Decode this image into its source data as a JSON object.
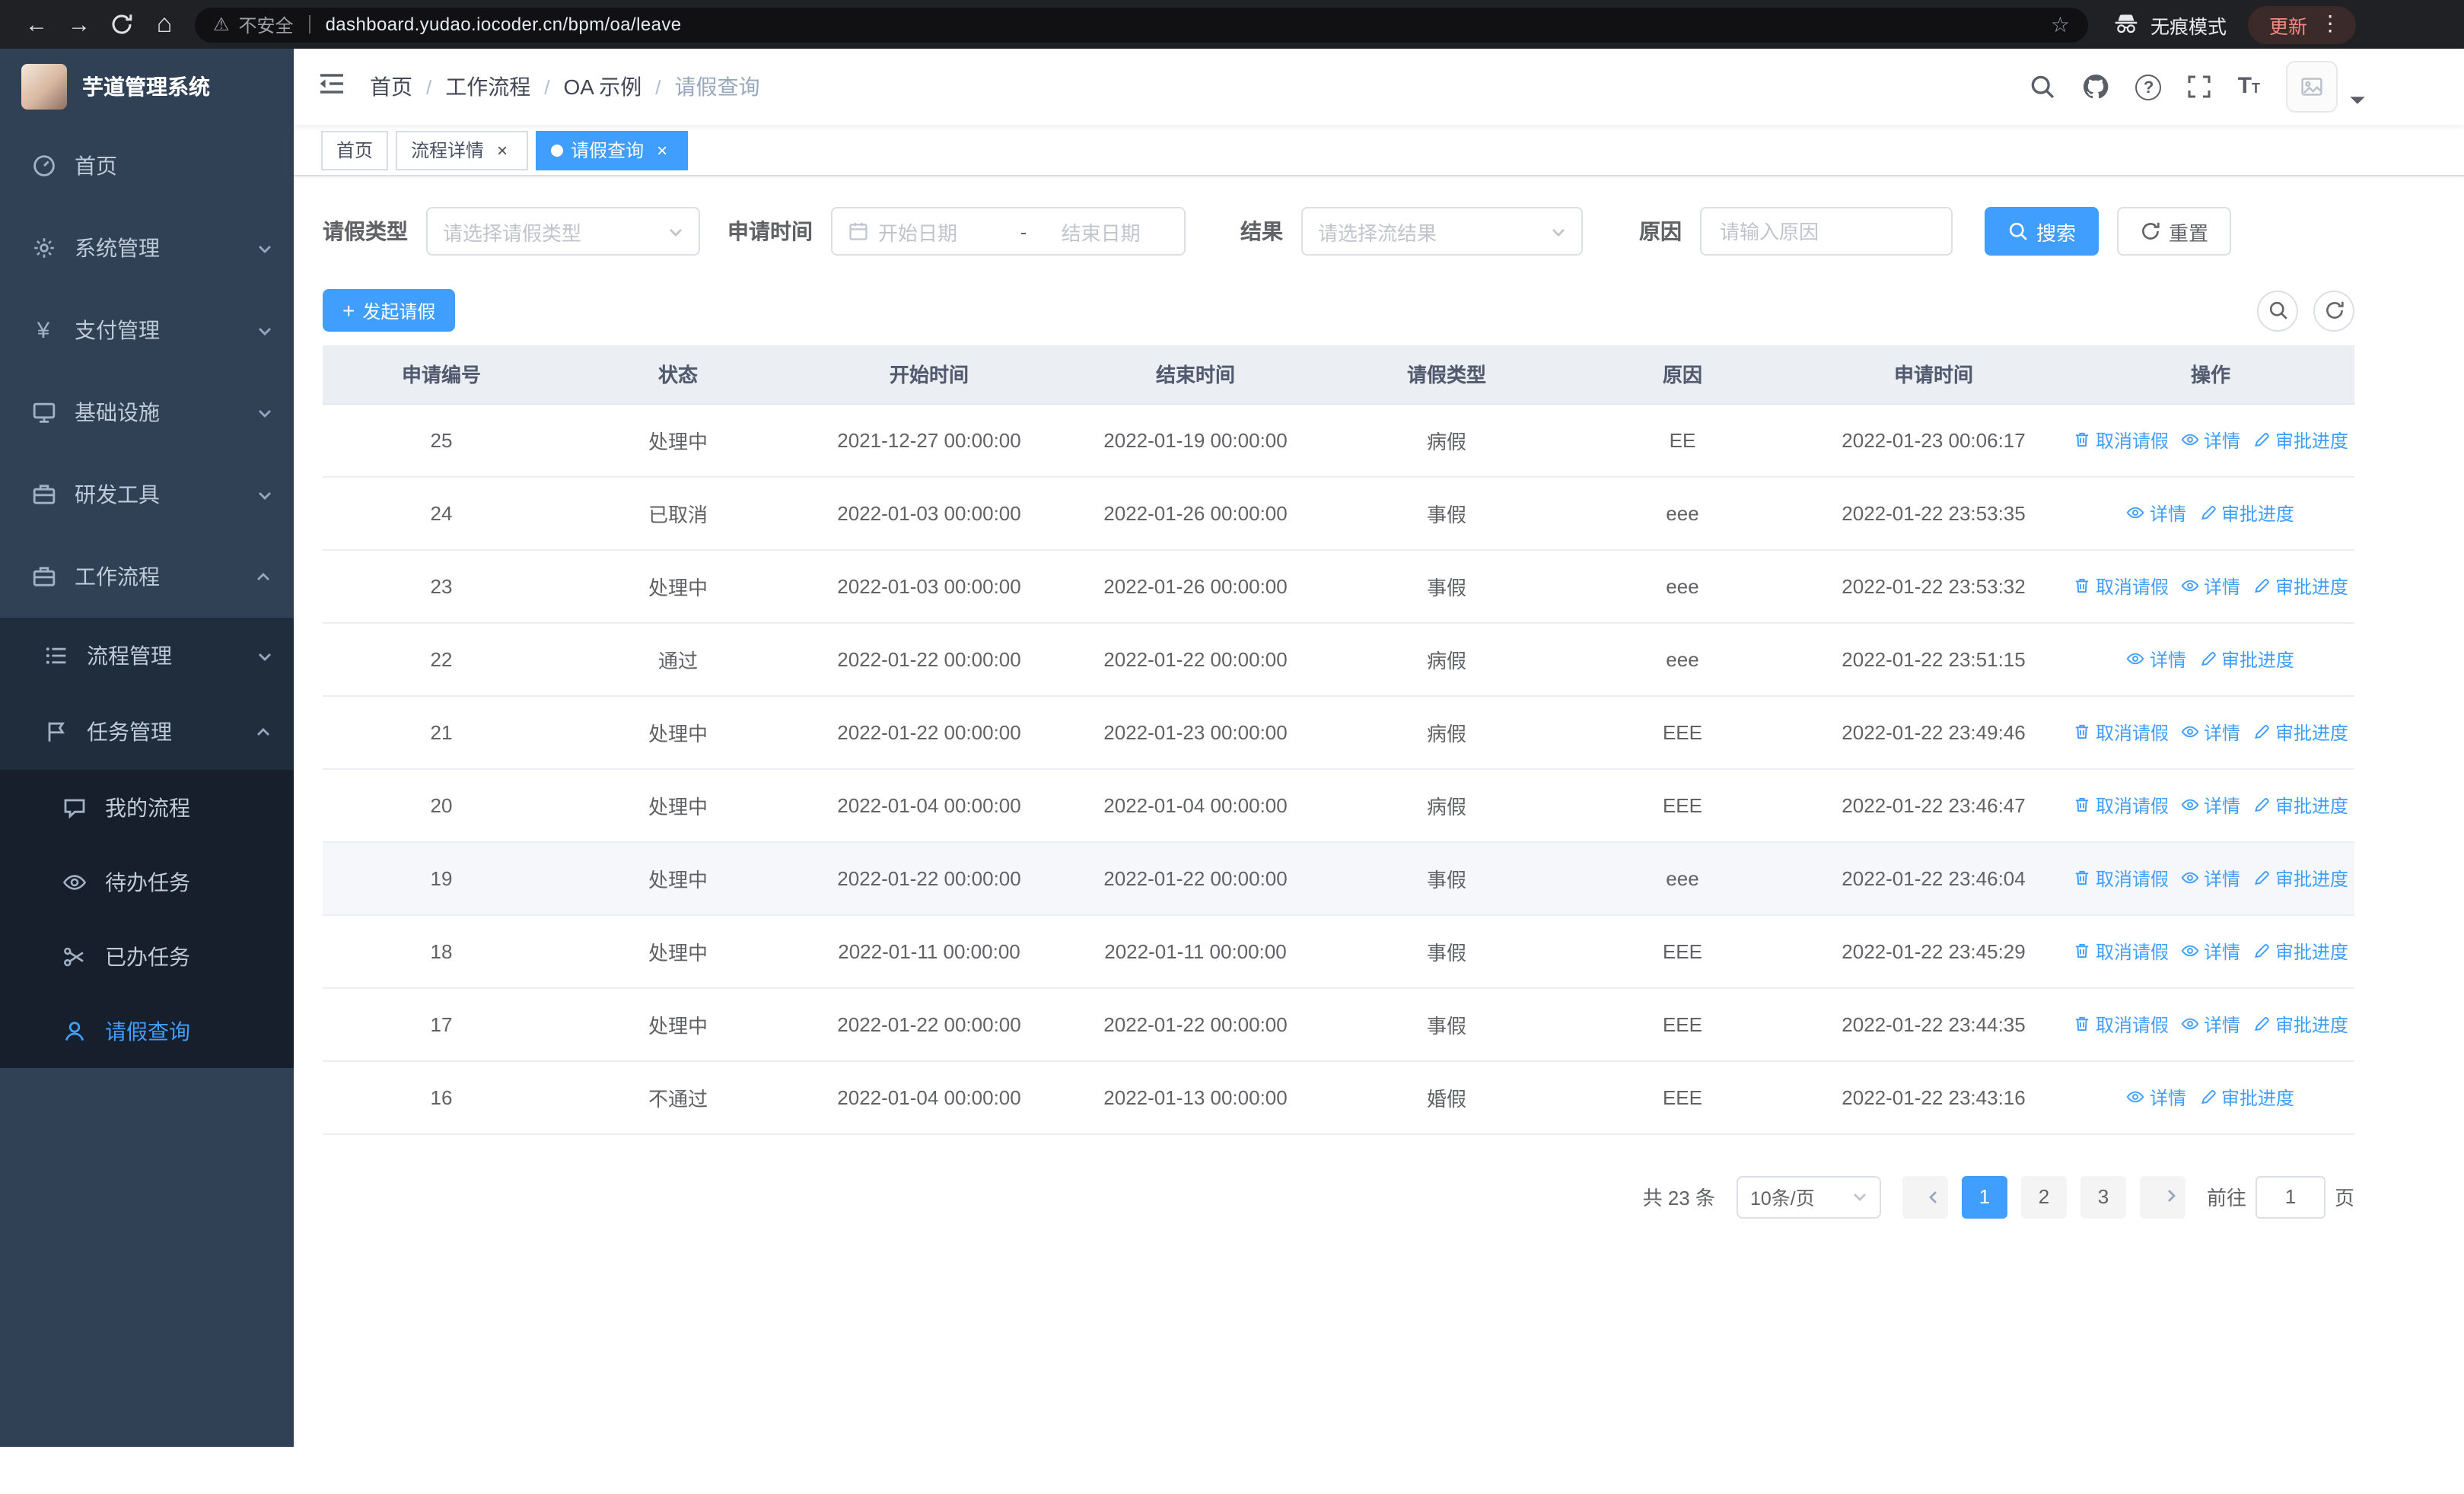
{
  "colors": {
    "accent": "#409eff",
    "sidebar_bg": "#304156",
    "sidebar_sub_bg": "#1f2d3d",
    "sidebar_subsub_bg": "#161f2b",
    "row_highlight": "#f5f7fa",
    "update_chip_text": "#f28b82"
  },
  "browser": {
    "security_label": "不安全",
    "url": "dashboard.yudao.iocoder.cn/bpm/oa/leave",
    "incognito_label": "无痕模式",
    "update_label": "更新"
  },
  "sidebar": {
    "title": "芋道管理系统",
    "logo_icon": "logo-image",
    "items": [
      {
        "label": "首页",
        "icon": "dashboard-icon",
        "has_children": false
      },
      {
        "label": "系统管理",
        "icon": "gear-icon",
        "has_children": true,
        "expanded": false
      },
      {
        "label": "支付管理",
        "icon": "yen-icon",
        "has_children": true,
        "expanded": false
      },
      {
        "label": "基础设施",
        "icon": "monitor-icon",
        "has_children": true,
        "expanded": false
      },
      {
        "label": "研发工具",
        "icon": "briefcase-icon",
        "has_children": true,
        "expanded": false
      },
      {
        "label": "工作流程",
        "icon": "suitcase-icon",
        "has_children": true,
        "expanded": true
      }
    ],
    "workflow_children": [
      {
        "label": "流程管理",
        "icon": "list-icon",
        "has_children": true,
        "expanded": false
      },
      {
        "label": "任务管理",
        "icon": "flag-icon",
        "has_children": true,
        "expanded": true
      }
    ],
    "task_children": [
      {
        "label": "我的流程",
        "icon": "chat-icon",
        "active": false
      },
      {
        "label": "待办任务",
        "icon": "eye-icon",
        "active": false
      },
      {
        "label": "已办任务",
        "icon": "scissors-icon",
        "active": false
      },
      {
        "label": "请假查询",
        "icon": "user-icon",
        "active": true
      }
    ]
  },
  "header": {
    "breadcrumb": [
      "首页",
      "工作流程",
      "OA 示例",
      "请假查询"
    ],
    "icons": [
      "search-icon",
      "github-icon",
      "help-icon",
      "fullscreen-icon",
      "font-size-icon",
      "avatar",
      "caret-down-icon"
    ]
  },
  "tabs": [
    {
      "label": "首页",
      "closable": false,
      "active": false
    },
    {
      "label": "流程详情",
      "closable": true,
      "active": false
    },
    {
      "label": "请假查询",
      "closable": true,
      "active": true
    }
  ],
  "filters": {
    "leave_type_label": "请假类型",
    "leave_type_placeholder": "请选择请假类型",
    "apply_time_label": "申请时间",
    "start_date_placeholder": "开始日期",
    "range_separator": "-",
    "end_date_placeholder": "结束日期",
    "result_label": "结果",
    "result_placeholder": "请选择流结果",
    "reason_label": "原因",
    "reason_placeholder": "请输入原因",
    "search_button": "搜索",
    "reset_button": "重置"
  },
  "toolbar": {
    "create_button": "发起请假",
    "icons": [
      "search-toggle-icon",
      "refresh-icon"
    ]
  },
  "table": {
    "columns": [
      "申请编号",
      "状态",
      "开始时间",
      "结束时间",
      "请假类型",
      "原因",
      "申请时间",
      "操作"
    ],
    "ops": {
      "cancel": "取消请假",
      "detail": "详情",
      "progress": "审批进度"
    },
    "rows": [
      {
        "id": "25",
        "status": "处理中",
        "start": "2021-12-27 00:00:00",
        "end": "2022-01-19 00:00:00",
        "type": "病假",
        "reason": "EE",
        "apply_time": "2022-01-23 00:06:17",
        "can_cancel": true,
        "highlighted": false
      },
      {
        "id": "24",
        "status": "已取消",
        "start": "2022-01-03 00:00:00",
        "end": "2022-01-26 00:00:00",
        "type": "事假",
        "reason": "eee",
        "apply_time": "2022-01-22 23:53:35",
        "can_cancel": false,
        "highlighted": false
      },
      {
        "id": "23",
        "status": "处理中",
        "start": "2022-01-03 00:00:00",
        "end": "2022-01-26 00:00:00",
        "type": "事假",
        "reason": "eee",
        "apply_time": "2022-01-22 23:53:32",
        "can_cancel": true,
        "highlighted": false
      },
      {
        "id": "22",
        "status": "通过",
        "start": "2022-01-22 00:00:00",
        "end": "2022-01-22 00:00:00",
        "type": "病假",
        "reason": "eee",
        "apply_time": "2022-01-22 23:51:15",
        "can_cancel": false,
        "highlighted": false
      },
      {
        "id": "21",
        "status": "处理中",
        "start": "2022-01-22 00:00:00",
        "end": "2022-01-23 00:00:00",
        "type": "病假",
        "reason": "EEE",
        "apply_time": "2022-01-22 23:49:46",
        "can_cancel": true,
        "highlighted": false
      },
      {
        "id": "20",
        "status": "处理中",
        "start": "2022-01-04 00:00:00",
        "end": "2022-01-04 00:00:00",
        "type": "病假",
        "reason": "EEE",
        "apply_time": "2022-01-22 23:46:47",
        "can_cancel": true,
        "highlighted": false
      },
      {
        "id": "19",
        "status": "处理中",
        "start": "2022-01-22 00:00:00",
        "end": "2022-01-22 00:00:00",
        "type": "事假",
        "reason": "eee",
        "apply_time": "2022-01-22 23:46:04",
        "can_cancel": true,
        "highlighted": true
      },
      {
        "id": "18",
        "status": "处理中",
        "start": "2022-01-11 00:00:00",
        "end": "2022-01-11 00:00:00",
        "type": "事假",
        "reason": "EEE",
        "apply_time": "2022-01-22 23:45:29",
        "can_cancel": true,
        "highlighted": false
      },
      {
        "id": "17",
        "status": "处理中",
        "start": "2022-01-22 00:00:00",
        "end": "2022-01-22 00:00:00",
        "type": "事假",
        "reason": "EEE",
        "apply_time": "2022-01-22 23:44:35",
        "can_cancel": true,
        "highlighted": false
      },
      {
        "id": "16",
        "status": "不通过",
        "start": "2022-01-04 00:00:00",
        "end": "2022-01-13 00:00:00",
        "type": "婚假",
        "reason": "EEE",
        "apply_time": "2022-01-22 23:43:16",
        "can_cancel": false,
        "highlighted": false
      }
    ]
  },
  "pagination": {
    "total_text": "共 23 条",
    "page_size": "10条/页",
    "pages": [
      "1",
      "2",
      "3"
    ],
    "active_page": "1",
    "goto_label": "前往",
    "goto_value": "1",
    "goto_unit": "页"
  }
}
